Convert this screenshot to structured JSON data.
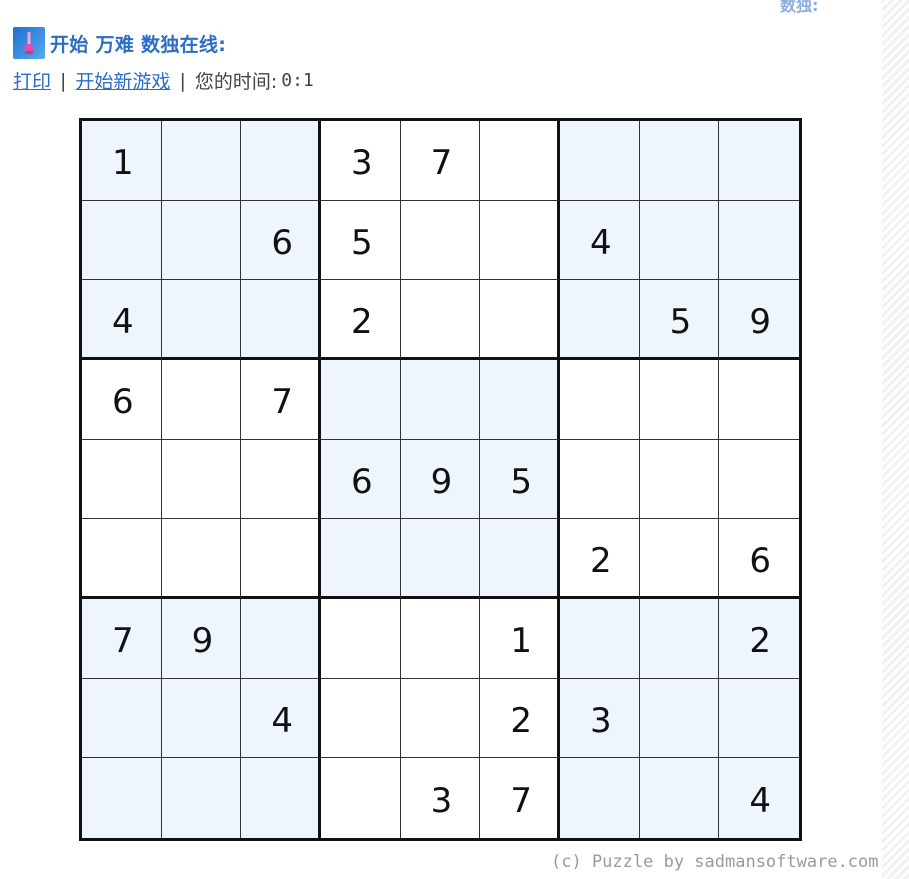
{
  "top_cut_text": "数独:",
  "header": {
    "logo_icon": "sudoku-logo-icon",
    "title": "开始 万难 数独在线:"
  },
  "links": {
    "print_label": "打印",
    "separator": "|",
    "new_game_label": "开始新游戏",
    "time_label": "您的时间:",
    "time_value": "0:1"
  },
  "board": {
    "rows": [
      [
        "1",
        "",
        "",
        "3",
        "7",
        "",
        "",
        "",
        ""
      ],
      [
        "",
        "",
        "6",
        "5",
        "",
        "",
        "4",
        "",
        ""
      ],
      [
        "4",
        "",
        "",
        "2",
        "",
        "",
        "",
        "5",
        "9"
      ],
      [
        "6",
        "",
        "7",
        "",
        "",
        "",
        "",
        "",
        ""
      ],
      [
        "",
        "",
        "",
        "6",
        "9",
        "5",
        "",
        "",
        ""
      ],
      [
        "",
        "",
        "",
        "",
        "",
        "",
        "2",
        "",
        "6"
      ],
      [
        "7",
        "9",
        "",
        "",
        "",
        "1",
        "",
        "",
        "2"
      ],
      [
        "",
        "",
        "4",
        "",
        "",
        "2",
        "3",
        "",
        ""
      ],
      [
        "",
        "",
        "",
        "",
        "3",
        "7",
        "",
        "",
        "4"
      ]
    ],
    "shade_color": "#eef5fd"
  },
  "credit": "(c) Puzzle by sadmansoftware.com"
}
